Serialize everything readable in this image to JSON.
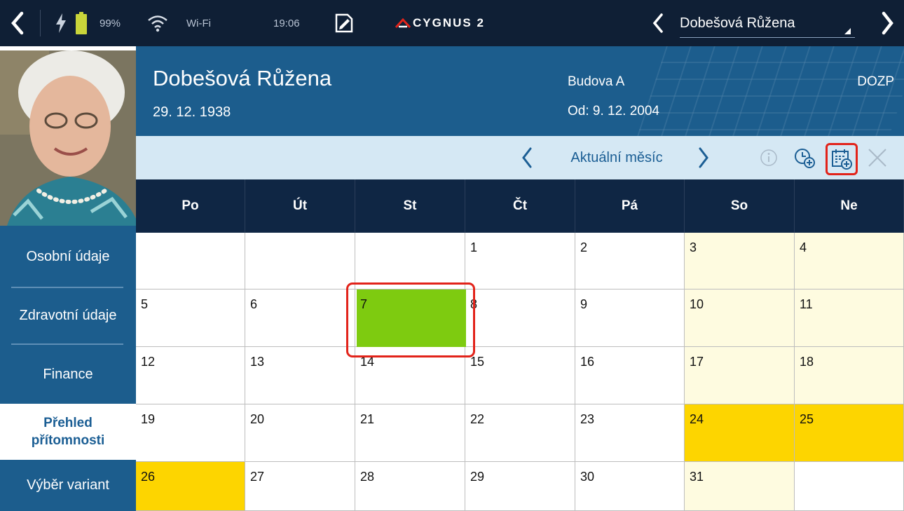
{
  "status_bar": {
    "battery": "99%",
    "wifi": "Wi-Fi",
    "time": "19:06",
    "brand": "CYGNUS 2",
    "patient_selector": "Dobešová Růžena"
  },
  "header": {
    "name": "Dobešová Růžena",
    "dob": "29. 12. 1938",
    "building": "Budova A",
    "from": "Od: 9. 12. 2004",
    "type": "DOZP"
  },
  "toolbar": {
    "month": "Aktuální měsíc"
  },
  "sidebar": {
    "items": [
      {
        "label": "Osobní údaje"
      },
      {
        "label": "Zdravotní údaje"
      },
      {
        "label": "Finance"
      },
      {
        "label_line1": "Přehled",
        "label_line2": "přítomnosti"
      },
      {
        "label": "Výběr variant"
      }
    ]
  },
  "calendar": {
    "weekdays": [
      "Po",
      "Út",
      "St",
      "Čt",
      "Pá",
      "So",
      "Ne"
    ],
    "weeks": [
      [
        "",
        "",
        "",
        "1",
        "2",
        "3",
        "4"
      ],
      [
        "5",
        "6",
        "7",
        "8",
        "9",
        "10",
        "11"
      ],
      [
        "12",
        "13",
        "14",
        "15",
        "16",
        "17",
        "18"
      ],
      [
        "19",
        "20",
        "21",
        "22",
        "23",
        "24",
        "25"
      ],
      [
        "26",
        "27",
        "28",
        "29",
        "30",
        "31",
        ""
      ]
    ],
    "colors": {
      "weekend": "#fefbe0",
      "holiday": "#fdd500",
      "marked": "#7ecb10",
      "highlight": "#e2231a"
    },
    "holidays": [
      "24",
      "25",
      "26"
    ],
    "marked_day": "7"
  }
}
